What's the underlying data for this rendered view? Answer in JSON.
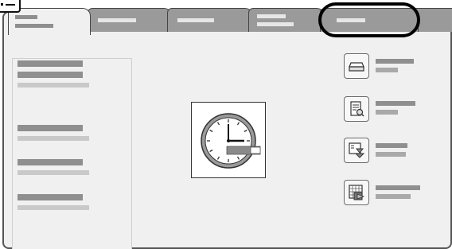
{
  "tabs": [
    {
      "id": "tab-1",
      "label": "",
      "selected": true
    },
    {
      "id": "tab-2",
      "label": "",
      "selected": false
    },
    {
      "id": "tab-3",
      "label": "",
      "selected": false
    },
    {
      "id": "tab-4",
      "label": "",
      "selected": false
    },
    {
      "id": "tab-5",
      "label": "",
      "selected": false,
      "highlighted": true
    }
  ],
  "info_items": [
    {
      "title": "",
      "value": ""
    },
    {
      "title": "",
      "value": ""
    },
    {
      "title": "",
      "value": ""
    },
    {
      "title": "",
      "value": ""
    }
  ],
  "clock": {
    "icon": "clock-icon",
    "time_shown": "2:58"
  },
  "actions": [
    {
      "icon": "tray-icon",
      "label": "",
      "sublabel": ""
    },
    {
      "icon": "document-search-icon",
      "label": "",
      "sublabel": ""
    },
    {
      "icon": "download-tray-icon",
      "label": "",
      "sublabel": ""
    },
    {
      "icon": "calendar-export-icon",
      "label": "",
      "sublabel": ""
    }
  ],
  "colors": {
    "panel_bg": "#f0f0f0",
    "tab_inactive": "#9a9a9a",
    "placeholder_text": "#8f8f8f",
    "highlight_ring": "#000000"
  }
}
